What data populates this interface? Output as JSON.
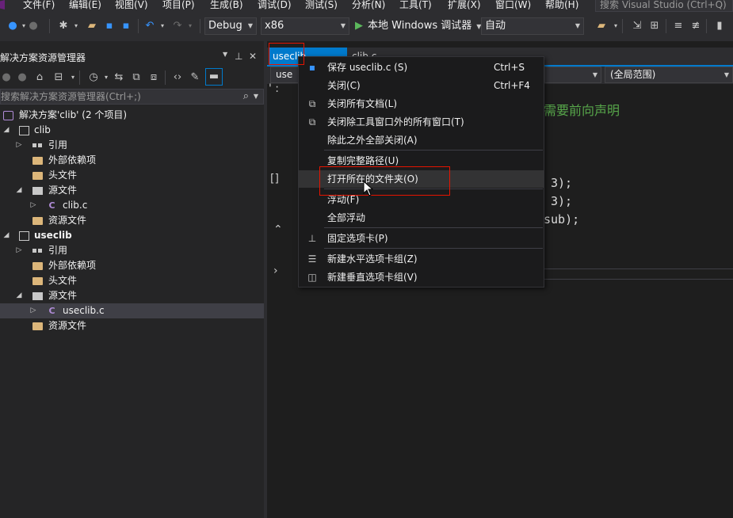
{
  "menubar": {
    "items": [
      "文件(F)",
      "编辑(E)",
      "视图(V)",
      "项目(P)",
      "生成(B)",
      "调试(D)",
      "测试(S)",
      "分析(N)",
      "工具(T)",
      "扩展(X)",
      "窗口(W)",
      "帮助(H)"
    ],
    "search_placeholder": "搜索 Visual Studio (Ctrl+Q)"
  },
  "toolbar": {
    "configuration": "Debug",
    "platform": "x86",
    "run_label": "本地 Windows 调试器",
    "run_mode": "自动"
  },
  "solution_explorer": {
    "title": "解决方案资源管理器",
    "search_placeholder": "搜索解决方案资源管理器(Ctrl+;)",
    "solution_label": "解决方案'clib' (2 个项目)",
    "tree": [
      {
        "label": "clib",
        "bold": false
      },
      {
        "label": "引用"
      },
      {
        "label": "外部依赖项"
      },
      {
        "label": "头文件"
      },
      {
        "label": "源文件"
      },
      {
        "label": "clib.c"
      },
      {
        "label": "资源文件"
      },
      {
        "label": "useclib",
        "bold": true
      },
      {
        "label": "引用"
      },
      {
        "label": "外部依赖项"
      },
      {
        "label": "头文件"
      },
      {
        "label": "源文件"
      },
      {
        "label": "useclib.c",
        "selected": true
      },
      {
        "label": "资源文件"
      }
    ]
  },
  "editor": {
    "tabs": [
      {
        "label": "useclib",
        "active": true
      },
      {
        "label": "clib.c",
        "active": false
      }
    ],
    "nav_left_visible": "use",
    "nav_scope": "(全局范围)",
    "code_fragments": {
      "comment": "需要前向声明",
      "line1": "3);",
      "line2": "3);",
      "line3": "sub);",
      "gutter_mark": "' :"
    }
  },
  "context_menu": {
    "items": [
      {
        "label": "保存 useclib.c (S)",
        "shortcut": "Ctrl+S",
        "icon": "save-icon"
      },
      {
        "label": "关闭(C)",
        "shortcut": "Ctrl+F4"
      },
      {
        "label": "关闭所有文档(L)",
        "icon": "close-all-icon"
      },
      {
        "label": "关闭除工具窗口外的所有窗口(T)",
        "icon": "close-windows-icon"
      },
      {
        "label": "除此之外全部关闭(A)"
      },
      {
        "label": "复制完整路径(U)"
      },
      {
        "label": "打开所在的文件夹(O)",
        "highlighted": true
      },
      {
        "label": "浮动(F)"
      },
      {
        "label": "全部浮动"
      },
      {
        "label": "固定选项卡(P)",
        "icon": "pin-icon"
      },
      {
        "label": "新建水平选项卡组(Z)",
        "icon": "horizontal-group-icon"
      },
      {
        "label": "新建垂直选项卡组(V)",
        "icon": "vertical-group-icon"
      }
    ]
  },
  "colors": {
    "accent": "#007acc",
    "annotation": "#e51400",
    "comment": "#57a64a",
    "background": "#1e1e1e"
  }
}
